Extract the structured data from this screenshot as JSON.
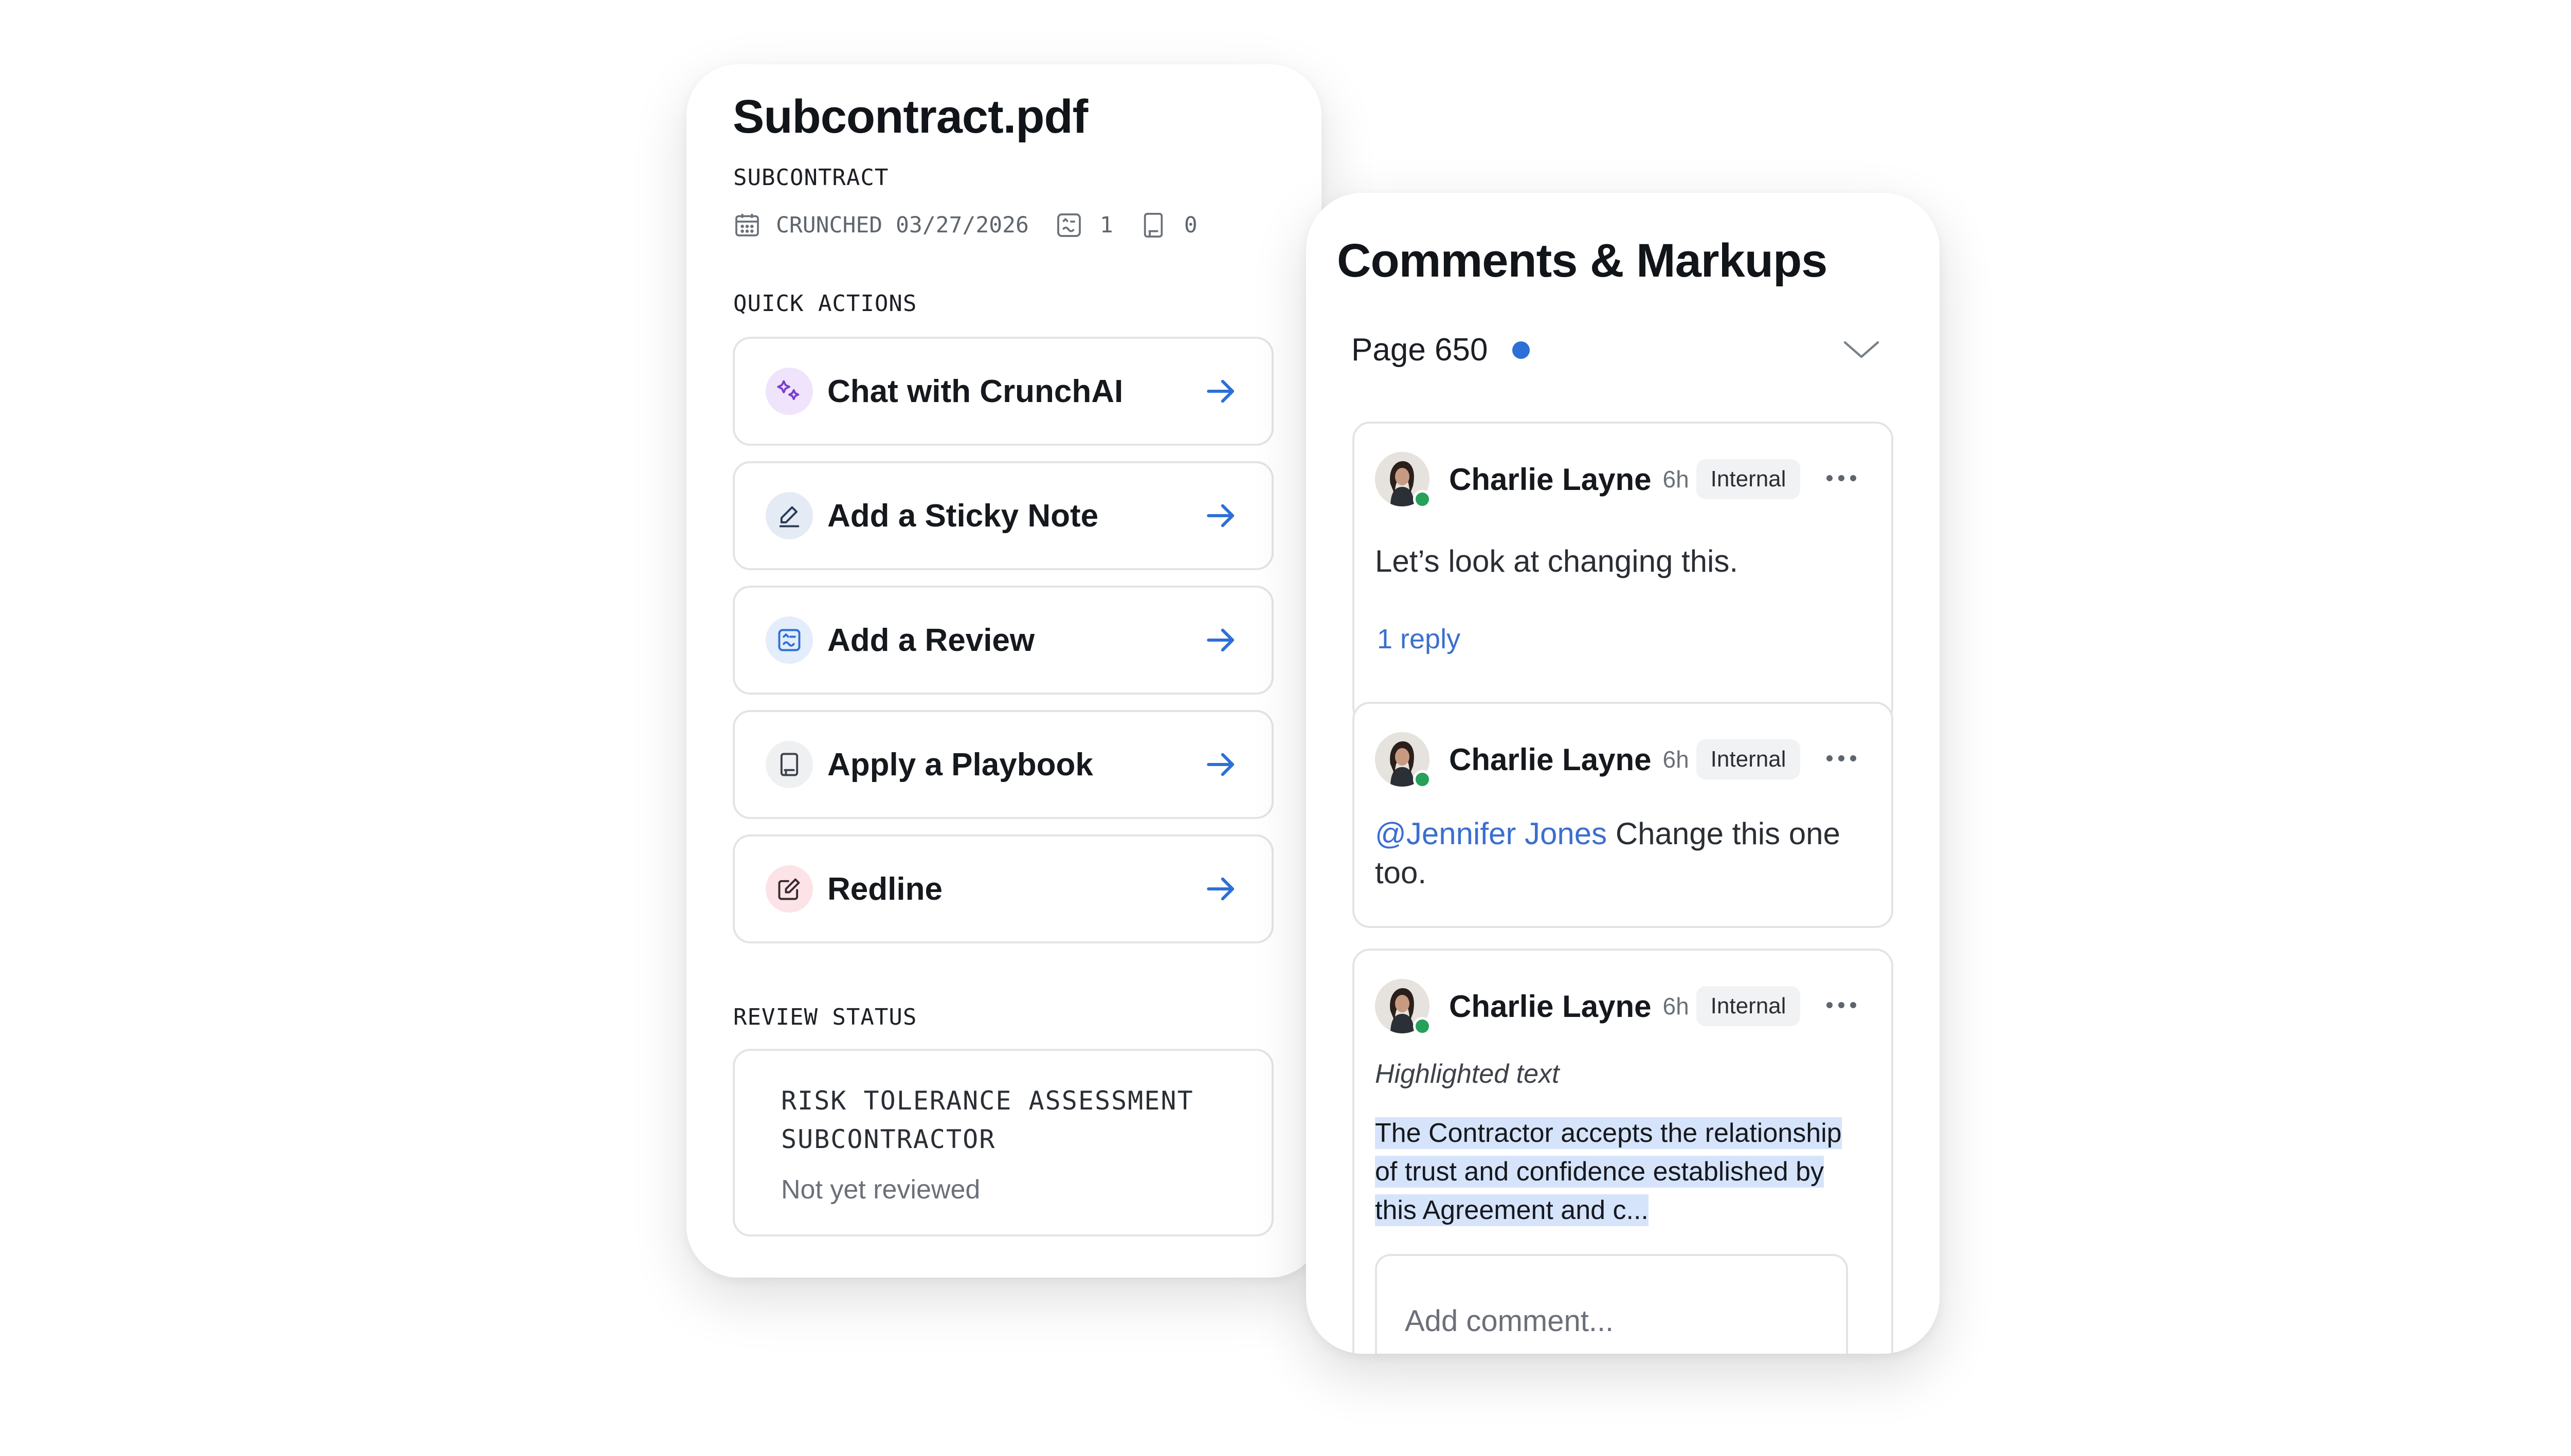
{
  "document": {
    "title": "Subcontract.pdf",
    "type": "SUBCONTRACT",
    "crunched": "CRUNCHED 03/27/2026",
    "review_count": "1",
    "playbook_count": "0"
  },
  "quick_actions": {
    "label": "QUICK ACTIONS",
    "items": [
      {
        "label": "Chat with CrunchAI",
        "icon": "ai-sparkle-icon"
      },
      {
        "label": "Add a Sticky Note",
        "icon": "pen-icon"
      },
      {
        "label": "Add a Review",
        "icon": "review-icon"
      },
      {
        "label": "Apply a Playbook",
        "icon": "playbook-icon"
      },
      {
        "label": "Redline",
        "icon": "edit-box-icon"
      }
    ]
  },
  "review_status": {
    "label": "REVIEW STATUS",
    "title": "RISK TOLERANCE ASSESSMENT SUBCONTRACTOR",
    "status": "Not yet reviewed"
  },
  "comments_panel": {
    "title": "Comments & Markups",
    "page": "Page 650",
    "comments": [
      {
        "author": "Charlie Layne",
        "time": "6h",
        "badge": "Internal",
        "text": "Let’s look at changing this.",
        "reply": "1 reply"
      },
      {
        "author": "Charlie Layne",
        "time": "6h",
        "badge": "Internal",
        "mention": "@Jennifer Jones",
        "text": " Change this one too."
      },
      {
        "author": "Charlie Layne",
        "time": "6h",
        "badge": "Internal",
        "caption": "Highlighted text",
        "highlight": "The Contractor accepts the relationship of trust and  confidence established by this Agreement and c...",
        "placeholder": "Add comment..."
      }
    ]
  },
  "colors": {
    "accent": "#3a6fcf",
    "online": "#27a05a",
    "highlight": "#d6e4fb"
  }
}
